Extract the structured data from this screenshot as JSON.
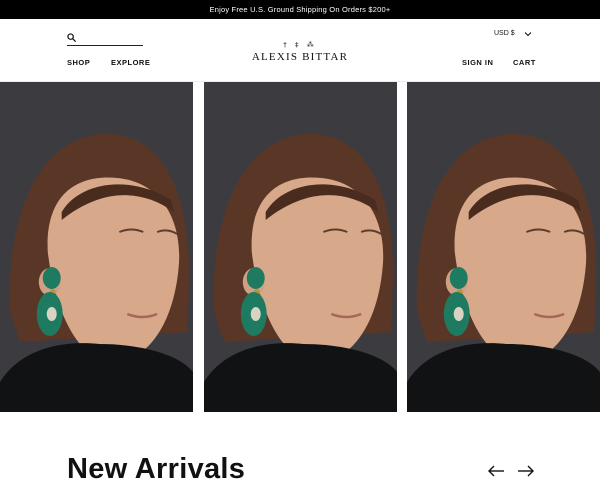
{
  "promo": {
    "text": "Enjoy Free U.S. Ground Shipping On Orders $200+"
  },
  "header": {
    "search": {
      "icon": "search-icon",
      "placeholder": "",
      "value": ""
    },
    "nav": {
      "shop": "SHOP",
      "explore": "EXPLORE"
    },
    "logo": {
      "symbols": "† ‡ ⁂",
      "text": "ALEXIS BITTAR"
    },
    "currency": {
      "label": "USD $",
      "icon": "chevron-down-icon"
    },
    "account": {
      "sign_in": "SIGN IN",
      "cart": "CART"
    }
  },
  "gallery": {
    "items": [
      {
        "alt": "Model wearing green malachite drop earring",
        "icon": "model-image"
      },
      {
        "alt": "Model wearing green malachite drop earring",
        "icon": "model-image"
      },
      {
        "alt": "Model wearing green malachite drop earring",
        "icon": "model-image"
      }
    ],
    "colors": {
      "background": "#3c3c40",
      "hair": "#5a3626",
      "skin": "#d7a889",
      "earring": "#1f7a62",
      "turtleneck": "#111214"
    }
  },
  "section": {
    "title": "New Arrivals",
    "prev_icon": "arrow-left-icon",
    "next_icon": "arrow-right-icon"
  }
}
